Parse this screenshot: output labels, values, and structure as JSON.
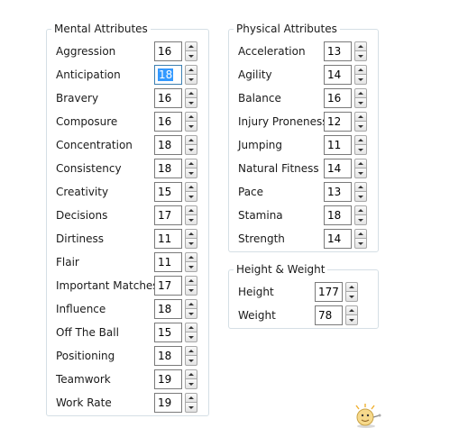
{
  "mental": {
    "title": "Mental Attributes",
    "items": [
      {
        "label": "Aggression",
        "value": "16"
      },
      {
        "label": "Anticipation",
        "value": "18"
      },
      {
        "label": "Bravery",
        "value": "16"
      },
      {
        "label": "Composure",
        "value": "16"
      },
      {
        "label": "Concentration",
        "value": "18"
      },
      {
        "label": "Consistency",
        "value": "18"
      },
      {
        "label": "Creativity",
        "value": "15"
      },
      {
        "label": "Decisions",
        "value": "17"
      },
      {
        "label": "Dirtiness",
        "value": "11"
      },
      {
        "label": "Flair",
        "value": "11"
      },
      {
        "label": "Important Matches",
        "value": "17"
      },
      {
        "label": "Influence",
        "value": "18"
      },
      {
        "label": "Off The Ball",
        "value": "15"
      },
      {
        "label": "Positioning",
        "value": "18"
      },
      {
        "label": "Teamwork",
        "value": "19"
      },
      {
        "label": "Work Rate",
        "value": "19"
      }
    ]
  },
  "physical": {
    "title": "Physical Attributes",
    "items": [
      {
        "label": "Acceleration",
        "value": "13"
      },
      {
        "label": "Agility",
        "value": "14"
      },
      {
        "label": "Balance",
        "value": "16"
      },
      {
        "label": "Injury Proneness",
        "value": "12"
      },
      {
        "label": "Jumping",
        "value": "11"
      },
      {
        "label": "Natural Fitness",
        "value": "14"
      },
      {
        "label": "Pace",
        "value": "13"
      },
      {
        "label": "Stamina",
        "value": "18"
      },
      {
        "label": "Strength",
        "value": "14"
      }
    ]
  },
  "hw": {
    "title": "Height & Weight",
    "items": [
      {
        "label": "Height",
        "value": "177"
      },
      {
        "label": "Weight",
        "value": "78"
      }
    ]
  },
  "selected_field": "mental.items.1",
  "icons": {
    "spinner_up": "up-arrow-icon",
    "spinner_down": "down-arrow-icon",
    "mascot": "mascot-icon"
  }
}
